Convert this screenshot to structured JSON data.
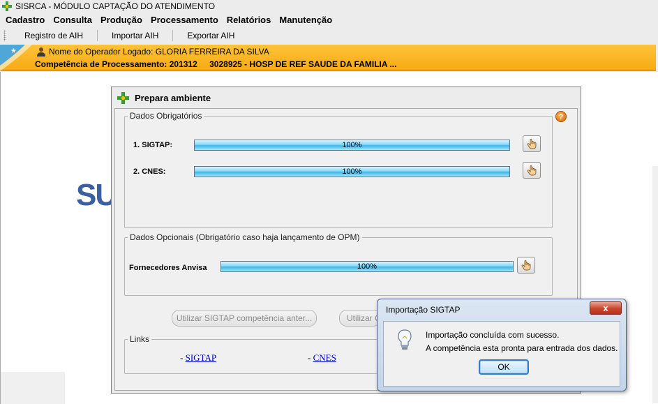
{
  "window": {
    "title": "SISRCA - MÓDULO CAPTAÇÃO DO ATENDIMENTO"
  },
  "menu": {
    "items": [
      "Cadastro",
      "Consulta",
      "Produção",
      "Processamento",
      "Relatórios",
      "Manutenção"
    ]
  },
  "toolbar": {
    "registro_label": "Registro de AIH",
    "importar_label": "Importar AIH",
    "exportar_label": "Exportar AIH"
  },
  "operator_bar": {
    "operator_line": "Nome do Operador Logado: GLORIA FERREIRA DA SILVA",
    "competencia_label": "Competência de Processamento: 201312",
    "hospital": "3028925 - HOSP DE REF SAUDE DA FAMILIA ..."
  },
  "background": {
    "logo_text": "SU"
  },
  "prepara": {
    "title": "Prepara ambiente",
    "obrigatorios": {
      "legend": "Dados Obrigatórios",
      "rows": [
        {
          "label": "1.  SIGTAP:",
          "progress": 100,
          "progress_text": "100%"
        },
        {
          "label": "2.  CNES:",
          "progress": 100,
          "progress_text": "100%"
        }
      ]
    },
    "opcionais": {
      "legend": "Dados Opcionais (Obrigatório caso haja lançamento de OPM)",
      "rows": [
        {
          "label": "Fornecedores Anvisa",
          "progress": 100,
          "progress_text": "100%"
        }
      ]
    },
    "buttons": {
      "utilizar_anterior": "Utilizar SIGTAP competência anter...",
      "utilizar_2": "Utilizar C"
    },
    "links": {
      "legend": "Links",
      "items": [
        {
          "prefix": "- ",
          "text": "SIGTAP"
        },
        {
          "prefix": "- ",
          "text": "CNES"
        }
      ]
    },
    "help": "?"
  },
  "dialog": {
    "title": "Importação SIGTAP",
    "close": "x",
    "message_line1": "Importação concluída com sucesso.",
    "message_line2": "A competência esta pronta para entrada dos dados.",
    "ok_label": "OK"
  },
  "colors": {
    "operator_bar": "#f7aa12",
    "progress": "#3fb6e8",
    "logo": "#3b5fa1",
    "link": "#0000cc"
  }
}
